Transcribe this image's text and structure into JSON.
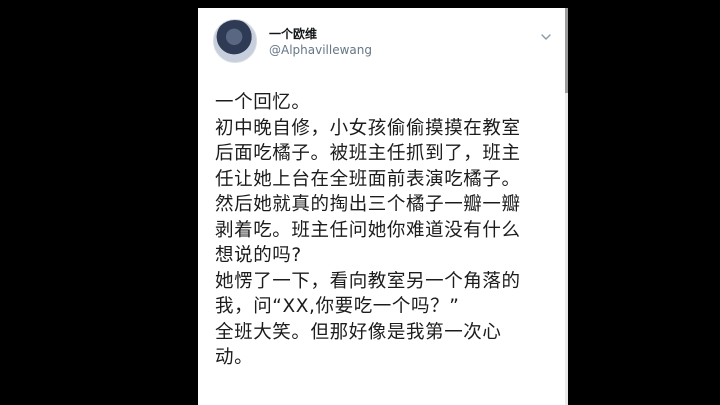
{
  "tweet": {
    "display_name": "一个欧维",
    "username": "@Alphavillewang",
    "lines": [
      "一个回忆。",
      "初中晚自修，小女孩偷偷摸摸在教室",
      "后面吃橘子。被班主任抓到了，班主",
      "任让她上台在全班面前表演吃橘子。",
      "然后她就真的掏出三个橘子一瓣一瓣",
      "剥着吃。班主任问她你难道没有什么",
      "想说的吗?",
      "她愣了一下，看向教室另一个角落的",
      "我，问“XX,你要吃一个吗？”",
      "全班大笑。但那好像是我第一次心",
      "动。"
    ]
  },
  "icons": {
    "avatar": "avatar-photo",
    "menu": "chevron-down-icon"
  },
  "colors": {
    "background": "#000000",
    "card": "#ffffff",
    "text": "#1c1c1c",
    "handle": "#657786"
  }
}
